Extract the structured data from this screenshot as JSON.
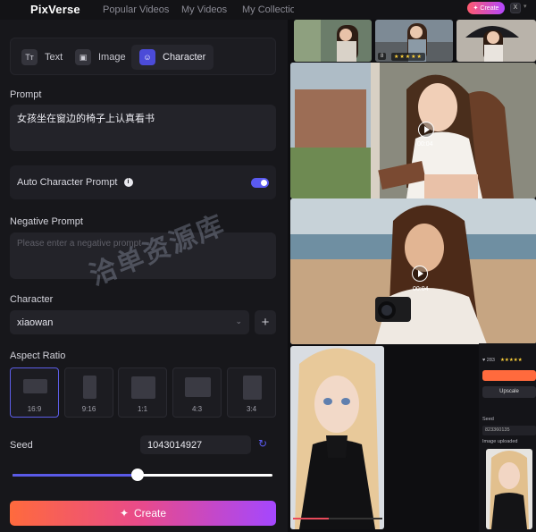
{
  "topbar": {
    "logo": "PixVerse",
    "nav": [
      "Popular Videos",
      "My Videos",
      "My Collections"
    ],
    "create_label": "Create",
    "avatar_initial": "X"
  },
  "mode_tabs": [
    {
      "label": "Text",
      "icon": "text-icon",
      "glyph": "Tт"
    },
    {
      "label": "Image",
      "icon": "image-icon",
      "glyph": "▣"
    },
    {
      "label": "Character",
      "icon": "character-icon",
      "glyph": "☺",
      "selected": true
    }
  ],
  "prompt": {
    "label": "Prompt",
    "value": "女孩坐在窗边的椅子上认真看书"
  },
  "auto_character_prompt": {
    "label": "Auto Character Prompt",
    "enabled": true
  },
  "negative_prompt": {
    "label": "Negative Prompt",
    "placeholder": "Please enter a negative prompt"
  },
  "character": {
    "label": "Character",
    "selected": "xiaowan"
  },
  "aspect_ratio": {
    "label": "Aspect Ratio",
    "options": [
      "16:9",
      "9:16",
      "1:1",
      "4:3",
      "3:4"
    ],
    "selected": "16:9"
  },
  "seed": {
    "label": "Seed",
    "value": "1043014927",
    "slider_fraction": 0.48
  },
  "create_button": {
    "label": "Create"
  },
  "watermark": "洽单资源库",
  "gallery": {
    "videos": [
      {
        "duration": "00:04"
      },
      {
        "duration": "00:04"
      }
    ],
    "thumb_likes": "8",
    "detail_likes": "283",
    "detail": {
      "upscale_label": "Upscale",
      "seed_label": "Seed",
      "seed_value": "823360135",
      "uploaded_label": "Image uploaded"
    }
  },
  "colors": {
    "accent": "#5a5af0",
    "create_gradient_start": "#ff6a3d",
    "create_gradient_end": "#a447ff",
    "panel_bg": "#17171b",
    "input_bg": "#232329"
  }
}
